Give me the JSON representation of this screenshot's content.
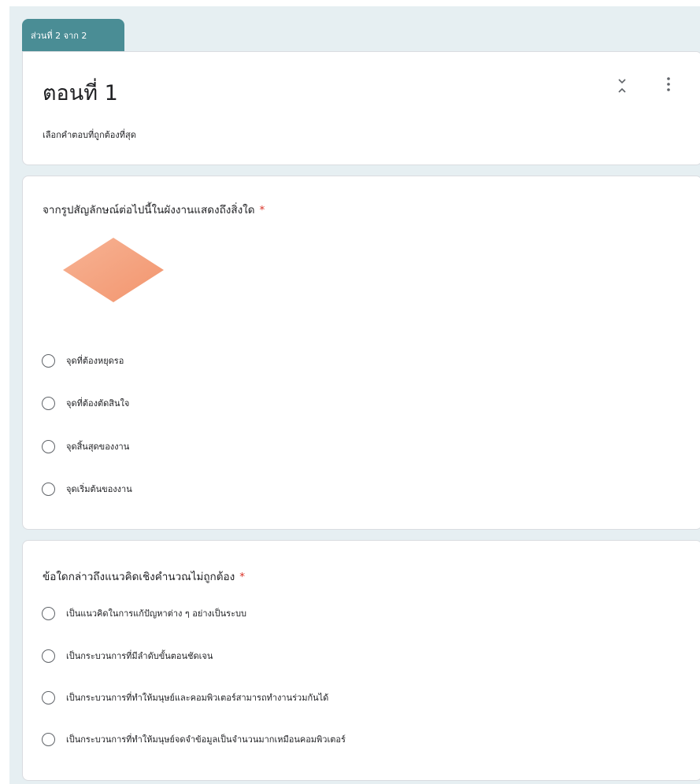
{
  "section": {
    "tab_label": "ส่วนที่ 2 จาก 2",
    "title": "ตอนที่ 1",
    "description": "เลือกคำตอบที่ถูกต้องที่สุด",
    "icons": [
      "collapse-icon",
      "more-vert-icon"
    ]
  },
  "questions": [
    {
      "title": "จากรูปสัญลักษณ์ต่อไปนี้ในผังงานแสดงถึงสิ่งใด",
      "required_mark": "*",
      "image": "diamond-flowchart-symbol",
      "image_color": "#f5a582",
      "options": [
        "จุดที่ต้องหยุดรอ",
        "จุดที่ต้องตัดสินใจ",
        "จุดสิ้นสุดของงาน",
        "จุดเริ่มต้นของงาน"
      ]
    },
    {
      "title": "ข้อใดกล่าวถึงแนวคิดเชิงคำนวณไม่ถูกต้อง",
      "required_mark": "*",
      "options": [
        "เป็นแนวคิดในการแก้ปัญหาต่าง ๆ อย่างเป็นระบบ",
        "เป็นกระบวนการที่มีลำดับขั้นตอนชัดเจน",
        "เป็นกระบวนการที่ทำให้มนุษย์และคอมพิวเตอร์สามารถทำงานร่วมกันได้",
        "เป็นกระบวนการที่ทำให้มนุษย์จดจำข้อมูลเป็นจำนวนมากเหมือนคอมพิวเตอร์"
      ]
    }
  ],
  "colors": {
    "accent": "#4a8d95",
    "background": "#e6eff2",
    "required": "#d93025"
  }
}
